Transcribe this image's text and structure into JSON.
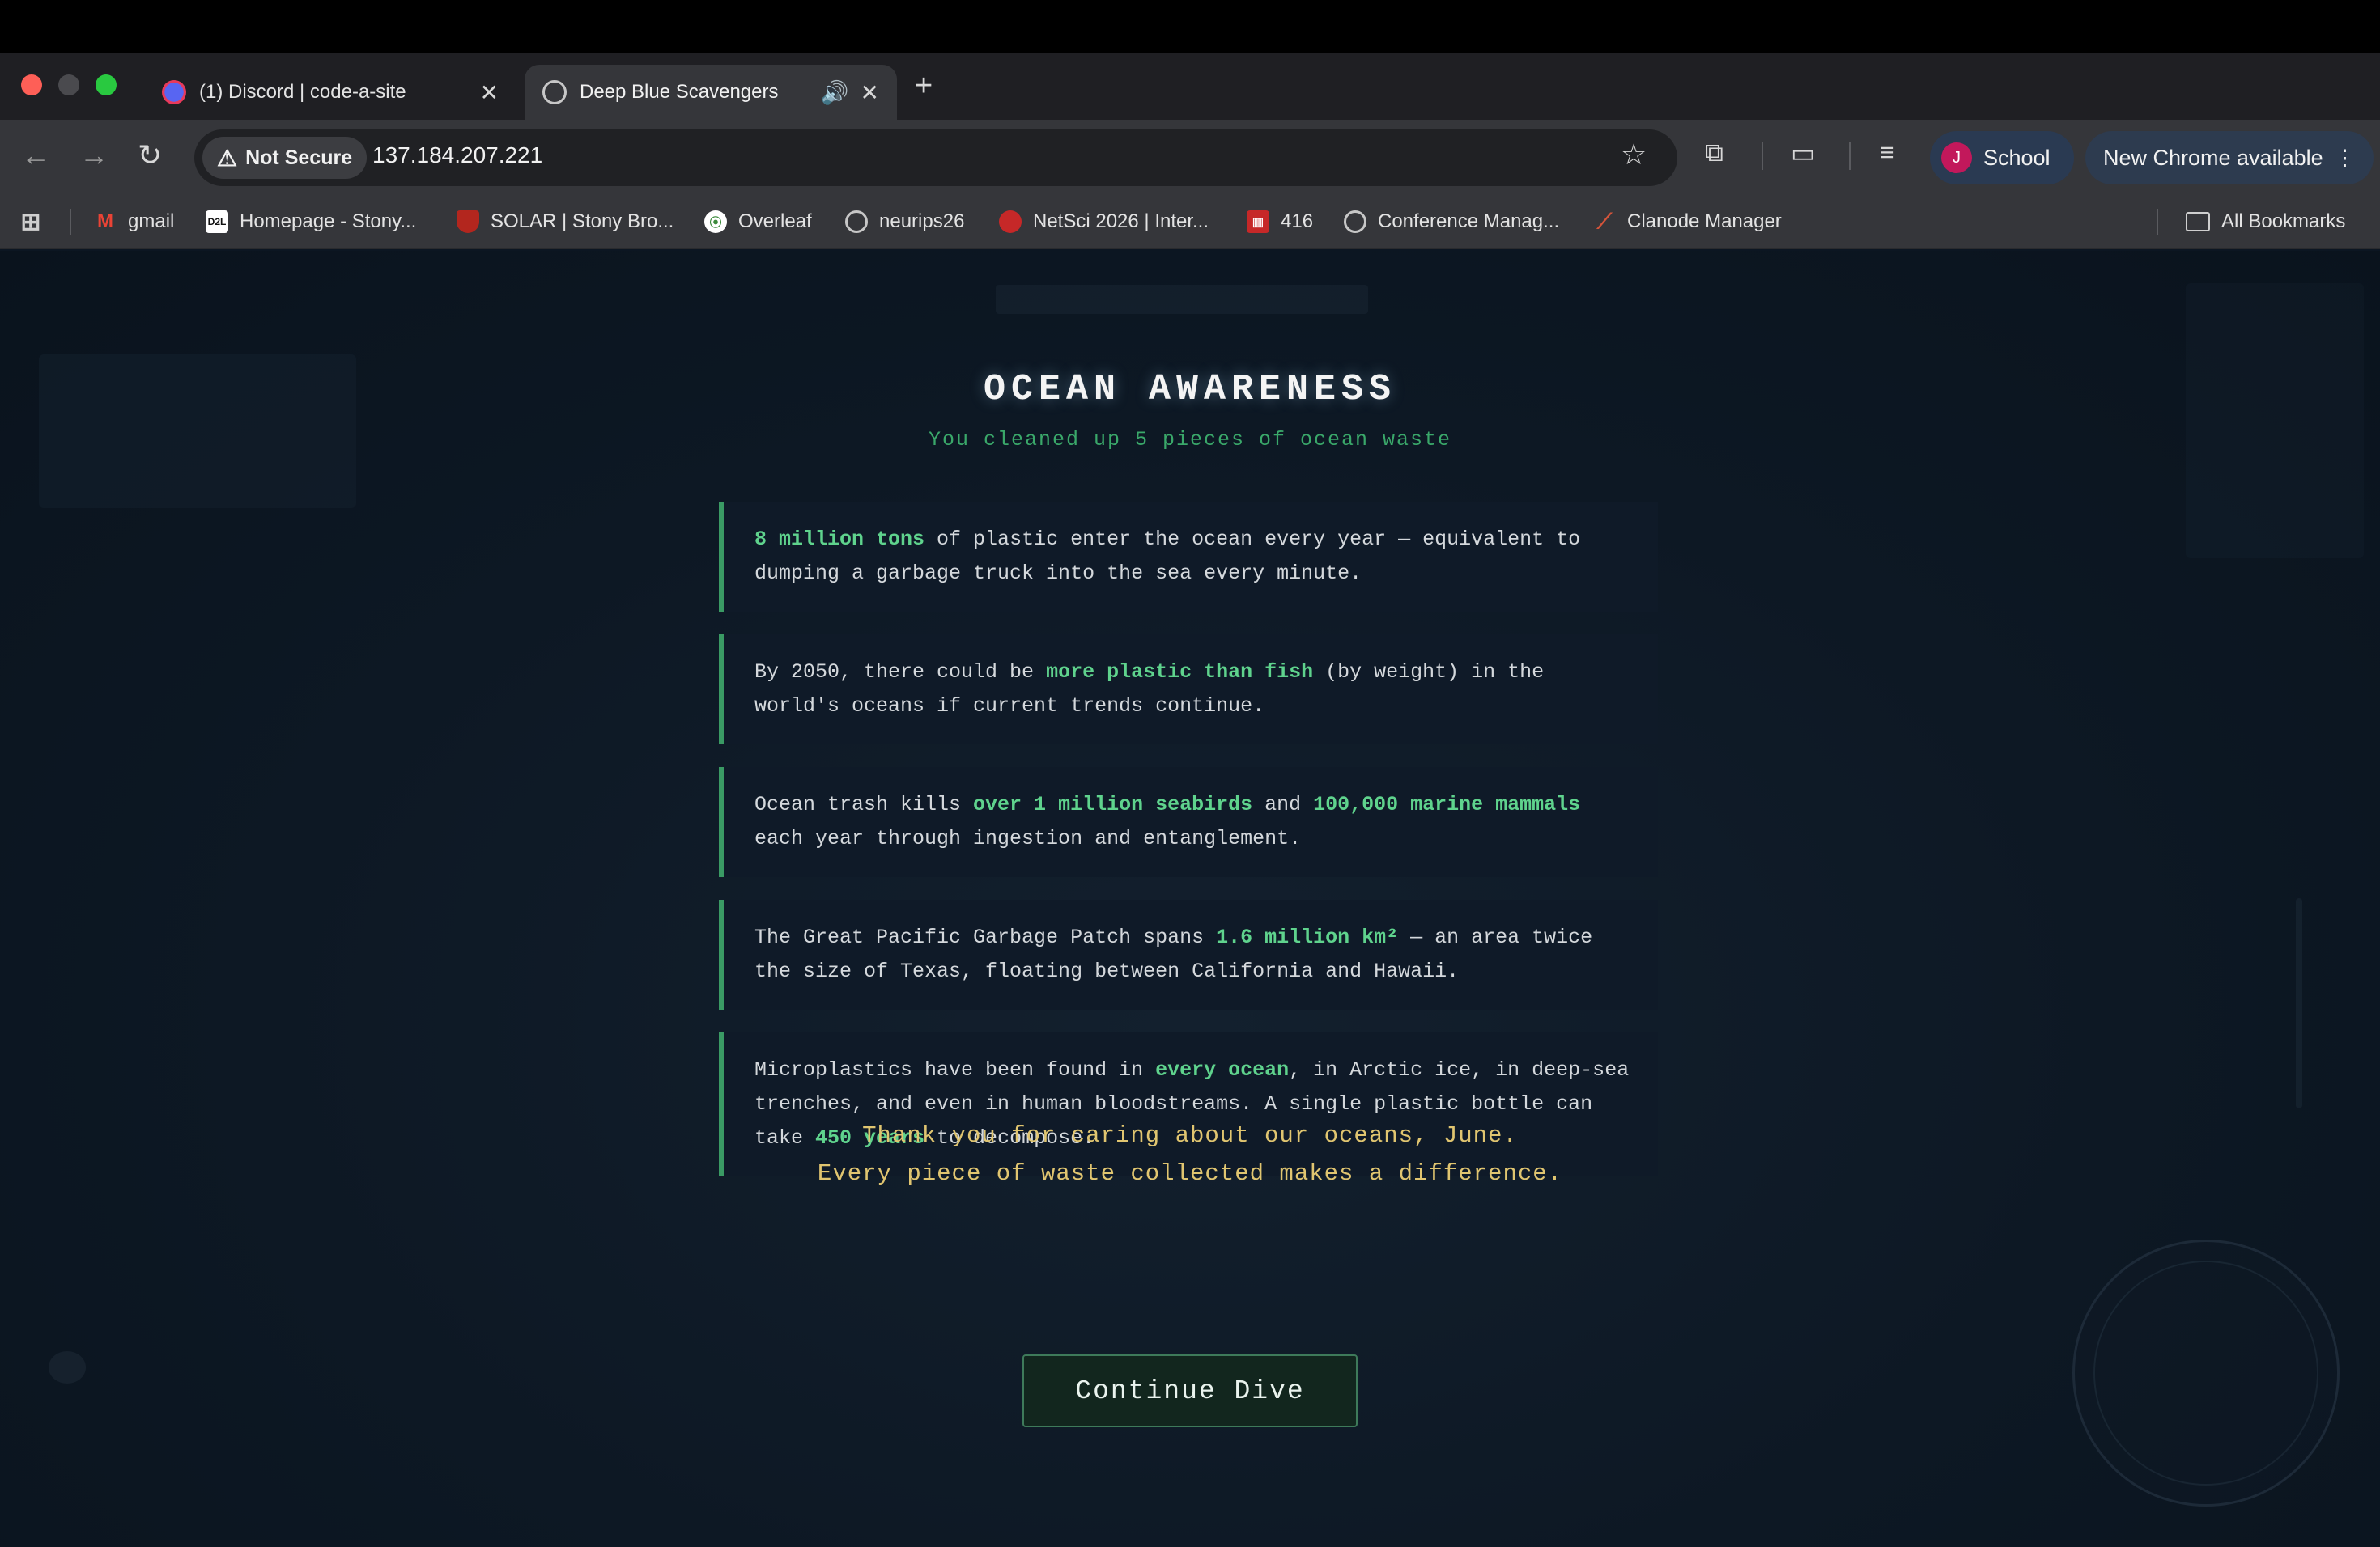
{
  "browser": {
    "tabs": [
      {
        "title": "(1) Discord | code-a-site",
        "icon": "discord-icon",
        "active": false
      },
      {
        "title": "Deep Blue Scavengers",
        "icon": "globe-icon",
        "active": true
      }
    ],
    "new_tab_label": "+",
    "security_label": "Not Secure",
    "url": "137.184.207.221",
    "profile_initial": "J",
    "profile_name": "School",
    "update_label": "New Chrome available",
    "bookmarks": [
      {
        "label": "gmail",
        "icon": "gmail-icon"
      },
      {
        "label": "Homepage - Stony...",
        "icon": "d2l-icon"
      },
      {
        "label": "SOLAR | Stony Bro...",
        "icon": "solar-icon"
      },
      {
        "label": "Overleaf",
        "icon": "overleaf-icon"
      },
      {
        "label": "neurips26",
        "icon": "globe-icon"
      },
      {
        "label": "NetSci 2026 | Inter...",
        "icon": "netsci-icon"
      },
      {
        "label": "416",
        "icon": "bookmark-416-icon"
      },
      {
        "label": "Conference Manag...",
        "icon": "globe-icon"
      },
      {
        "label": "Clanode Manager",
        "icon": "claude-icon"
      }
    ],
    "all_bookmarks_label": "All Bookmarks"
  },
  "page": {
    "title": "OCEAN AWARENESS",
    "subtitle": "You cleaned up 5 pieces of ocean waste",
    "facts": [
      {
        "pre1": "",
        "hl1": "8 million tons",
        "mid1": " of plastic enter the ocean every year — equivalent to dumping a garbage truck into the sea every minute.",
        "hl2": "",
        "post": ""
      },
      {
        "pre1": "By 2050, there could be ",
        "hl1": "more plastic than fish",
        "mid1": " (by weight) in the world's oceans if current trends continue.",
        "hl2": "",
        "post": ""
      },
      {
        "pre1": "Ocean trash kills ",
        "hl1": "over 1 million seabirds",
        "mid1": " and ",
        "hl2": "100,000 marine mammals",
        "post": " each year through ingestion and entanglement."
      },
      {
        "pre1": "The Great Pacific Garbage Patch spans ",
        "hl1": "1.6 million km²",
        "mid1": " — an area twice the size of Texas, floating between California and Hawaii.",
        "hl2": "",
        "post": ""
      },
      {
        "pre1": "Microplastics have been found in ",
        "hl1": "every ocean",
        "mid1": ", in Arctic ice, in deep-sea trenches, and even in human bloodstreams. A single plastic bottle can take ",
        "hl2": "450 years",
        "post": " to decompose."
      }
    ],
    "thanks_line1": "Thank you for caring about our oceans, June.",
    "thanks_line2": "Every piece of waste collected makes a difference.",
    "continue_label": "Continue Dive"
  },
  "colors": {
    "accent_green": "#5fd38d",
    "thanks_gold": "#e0c570",
    "background": "#0c1622"
  }
}
